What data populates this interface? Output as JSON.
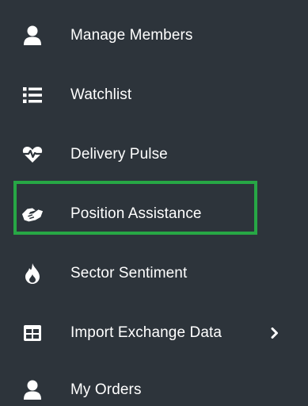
{
  "colors": {
    "background": "#2d343b",
    "text": "#ffffff",
    "highlight": "#27a745"
  },
  "menu": {
    "items": [
      {
        "label": "Manage Members",
        "icon": "user-icon"
      },
      {
        "label": "Watchlist",
        "icon": "list-icon"
      },
      {
        "label": "Delivery Pulse",
        "icon": "heartbeat-icon"
      },
      {
        "label": "Position Assistance",
        "icon": "handshake-icon",
        "highlighted": true
      },
      {
        "label": "Sector Sentiment",
        "icon": "fire-icon"
      },
      {
        "label": "Import Exchange Data",
        "icon": "table-icon",
        "has_submenu": true,
        "submenu_icon": "chevron-right-icon"
      },
      {
        "label": "My Orders",
        "icon": "user-icon"
      }
    ]
  }
}
